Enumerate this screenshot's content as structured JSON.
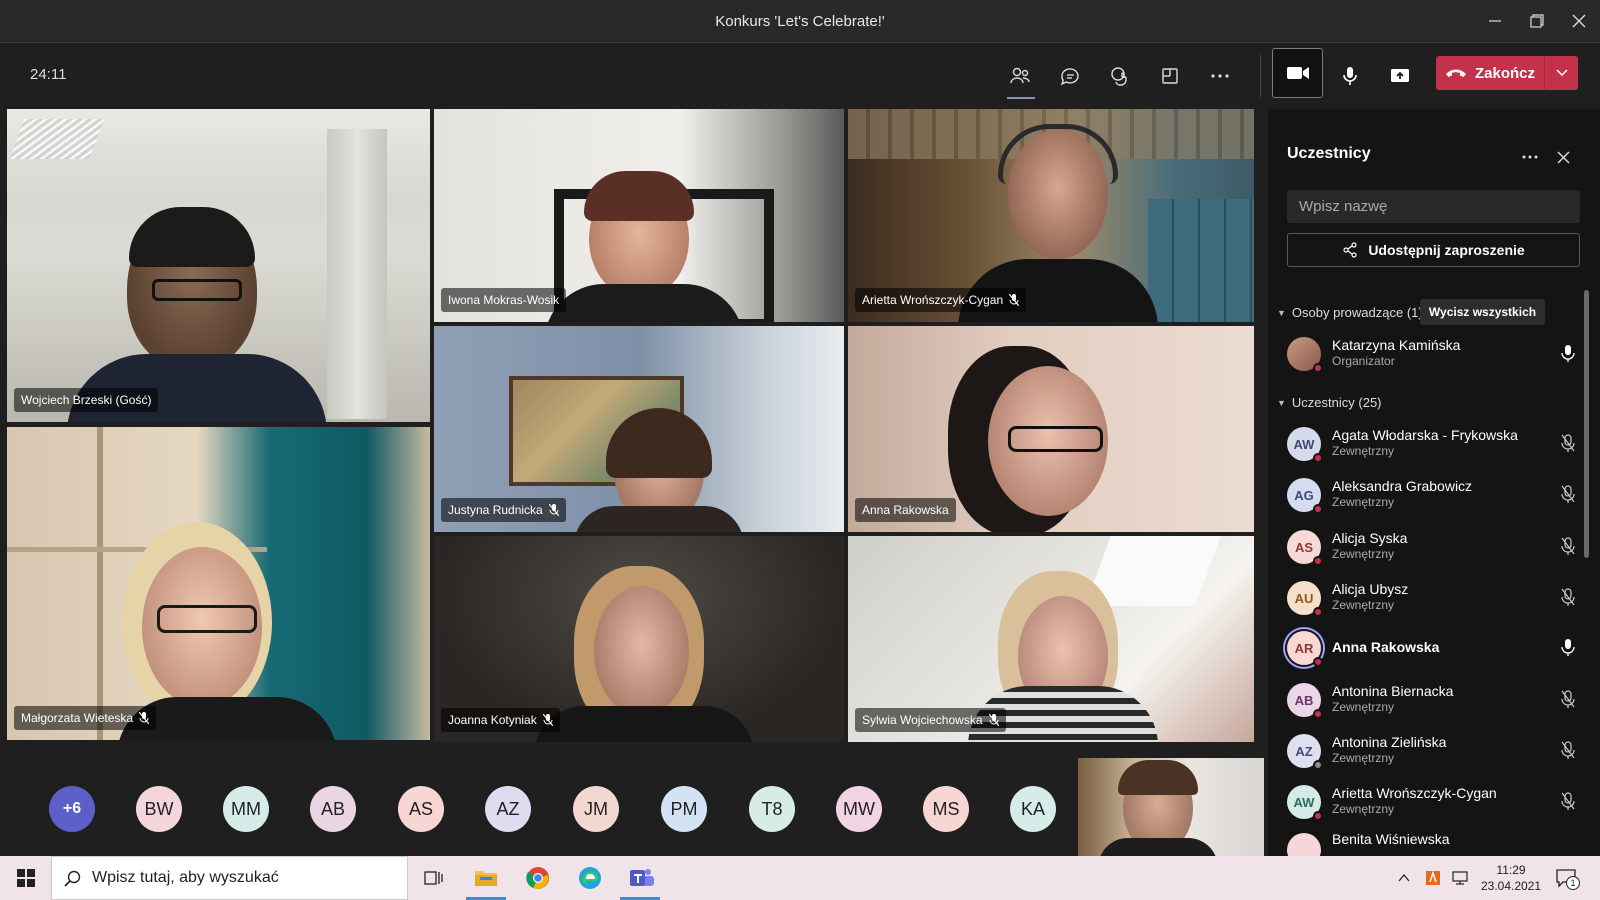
{
  "window": {
    "title": "Konkurs 'Let's Celebrate!'"
  },
  "toolbar": {
    "timer": "24:11",
    "end_label": "Zakończ"
  },
  "tiles": [
    {
      "name": "Wojciech Brzeski (Gość)",
      "muted": false
    },
    {
      "name": "Iwona Mokras-Wosik",
      "muted": false
    },
    {
      "name": "Arietta Wrońszczyk-Cygan",
      "muted": true
    },
    {
      "name": "Justyna Rudnicka",
      "muted": true
    },
    {
      "name": "Anna Rakowska",
      "muted": false
    },
    {
      "name": "Małgorzata Wieteska",
      "muted": true
    },
    {
      "name": "Joanna Kotyniak",
      "muted": true
    },
    {
      "name": "Sylwia Wojciechowska",
      "muted": true
    }
  ],
  "strip": {
    "more": "+6",
    "avatars": [
      "BW",
      "MM",
      "AB",
      "AS",
      "AZ",
      "JM",
      "PM",
      "T8",
      "MW",
      "MS",
      "KA"
    ]
  },
  "panel": {
    "title": "Uczestnicy",
    "search_placeholder": "Wpisz nazwę",
    "invite_label": "Udostępnij zaproszenie",
    "presenters_label": "Osoby prowadzące (1)",
    "lower_all_label": "Wycisz wszystkich",
    "attendees_label": "Uczestnicy (25)",
    "presenters": [
      {
        "name": "Katarzyna Kamińska",
        "role": "Organizator"
      }
    ],
    "attendees": [
      {
        "initials": "AW",
        "name": "Agata Włodarska - Frykowska",
        "role": "Zewnętrzny",
        "muted": true
      },
      {
        "initials": "AG",
        "name": "Aleksandra Grabowicz",
        "role": "Zewnętrzny",
        "muted": true
      },
      {
        "initials": "AS",
        "name": "Alicja Syska",
        "role": "Zewnętrzny",
        "muted": true
      },
      {
        "initials": "AU",
        "name": "Alicja Ubysz",
        "role": "Zewnętrzny",
        "muted": true
      },
      {
        "initials": "AR",
        "name": "Anna Rakowska",
        "role": "",
        "muted": false
      },
      {
        "initials": "AB",
        "name": "Antonina Biernacka",
        "role": "Zewnętrzny",
        "muted": true
      },
      {
        "initials": "AZ",
        "name": "Antonina Zielińska",
        "role": "Zewnętrzny",
        "muted": true
      },
      {
        "initials": "AW",
        "name": "Arietta Wrońszczyk-Cygan",
        "role": "Zewnętrzny",
        "muted": true
      },
      {
        "initials": "BW",
        "name": "Benita Wiśniewska",
        "role": "",
        "muted": true
      }
    ]
  },
  "taskbar": {
    "search_placeholder": "Wpisz tutaj, aby wyszukać",
    "time": "11:29",
    "date": "23.04.2021",
    "notifications": "1"
  }
}
